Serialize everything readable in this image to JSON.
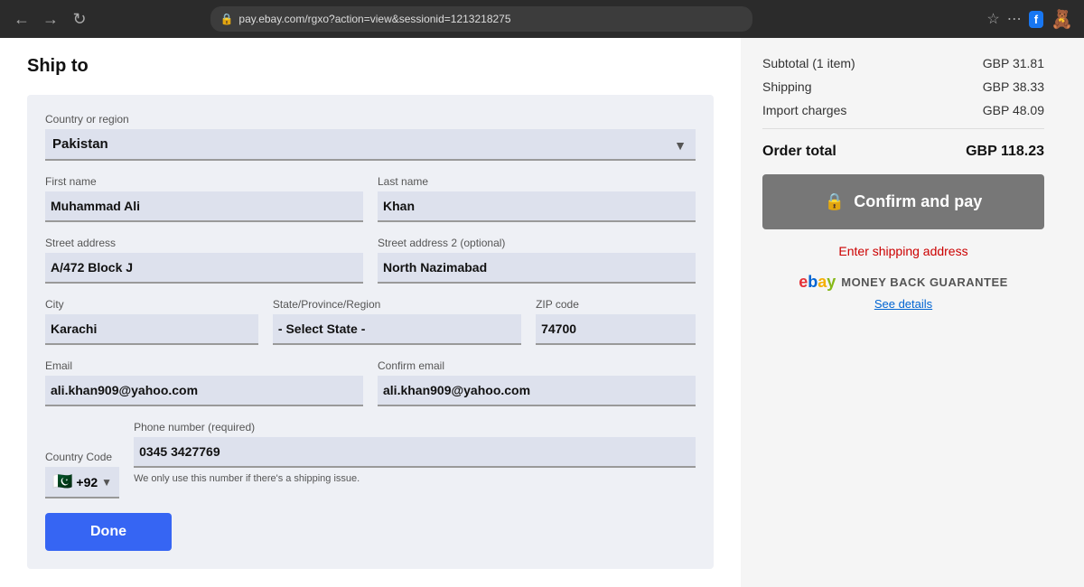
{
  "browser": {
    "url": "pay.ebay.com/rgxo?action=view&sessionid=1213218275"
  },
  "main": {
    "ship_to_label": "Ship to",
    "form": {
      "country_label": "Country or region",
      "country_value": "Pakistan",
      "first_name_label": "First name",
      "first_name_value": "Muhammad Ali",
      "last_name_label": "Last name",
      "last_name_value": "Khan",
      "street1_label": "Street address",
      "street1_value": "A/472 Block J",
      "street2_label": "Street address 2 (optional)",
      "street2_value": "North Nazimabad",
      "city_label": "City",
      "city_value": "Karachi",
      "state_label": "State/Province/Region",
      "state_value": "- Select State -",
      "zip_label": "ZIP code",
      "zip_value": "74700",
      "email_label": "Email",
      "email_value": "ali.khan909@yahoo.com",
      "confirm_email_label": "Confirm email",
      "confirm_email_value": "ali.khan909@yahoo.com",
      "country_code_label": "Country Code",
      "country_code_value": "+92",
      "phone_label": "Phone number (required)",
      "phone_value": "0345 3427769",
      "phone_hint": "We only use this number if there's a shipping issue.",
      "done_label": "Done"
    }
  },
  "sidebar": {
    "subtotal_label": "Subtotal (1 item)",
    "subtotal_value": "GBP 31.81",
    "shipping_label": "Shipping",
    "shipping_value": "GBP 38.33",
    "import_label": "Import charges",
    "import_value": "GBP 48.09",
    "order_total_label": "Order total",
    "order_total_value": "GBP 118.23",
    "confirm_btn_label": "Confirm and pay",
    "shipping_address_link": "Enter shipping address",
    "money_back_text": "MONEY BACK GUARANTEE",
    "see_details_label": "See details"
  }
}
